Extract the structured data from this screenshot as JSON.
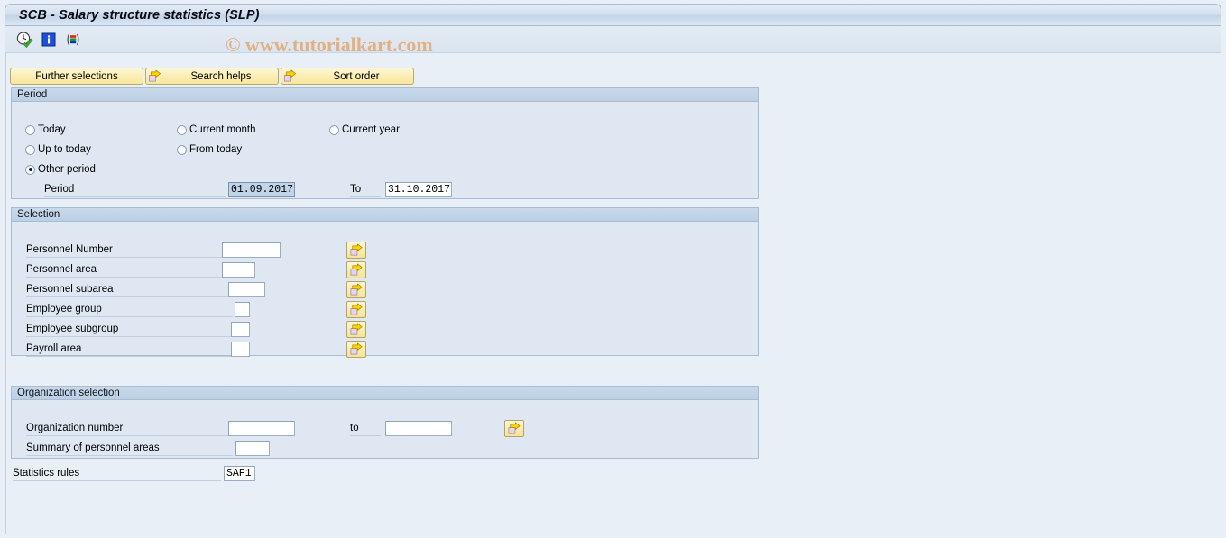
{
  "window": {
    "title": "SCB - Salary structure statistics (SLP)"
  },
  "watermark": {
    "text": "© www.tutorialkart.com"
  },
  "toolbar": {
    "icons": [
      {
        "name": "execute-clock-icon",
        "title": "Execute"
      },
      {
        "name": "information-icon",
        "title": "Information"
      },
      {
        "name": "variant-bars-icon",
        "title": "Get Variant"
      }
    ]
  },
  "buttons": {
    "further_selections": "Further selections",
    "search_helps": "Search helps",
    "sort_order": "Sort order"
  },
  "period": {
    "title": "Period",
    "options": [
      {
        "label": "Today",
        "checked": false
      },
      {
        "label": "Current month",
        "checked": false
      },
      {
        "label": "Current year",
        "checked": false
      },
      {
        "label": "Up to today",
        "checked": false
      },
      {
        "label": "From today",
        "checked": false
      },
      {
        "label": "Other period",
        "checked": true
      }
    ],
    "period_label": "Period",
    "period_from": "01.09.2017",
    "to_label": "To",
    "period_to": "31.10.2017"
  },
  "selection": {
    "title": "Selection",
    "rows": [
      {
        "label": "Personnel Number",
        "value": ""
      },
      {
        "label": "Personnel area",
        "value": ""
      },
      {
        "label": "Personnel subarea",
        "value": ""
      },
      {
        "label": "Employee group",
        "value": ""
      },
      {
        "label": "Employee subgroup",
        "value": ""
      },
      {
        "label": "Payroll area",
        "value": ""
      }
    ]
  },
  "organization": {
    "title": "Organization selection",
    "org_number_label": "Organization number",
    "org_number_from": "",
    "to_label": "to",
    "org_number_to": "",
    "summary_label": "Summary of personnel areas",
    "summary_value": ""
  },
  "statistics": {
    "label": "Statistics rules",
    "value": "SAF1"
  },
  "colors": {
    "page_background": "#e9eff6",
    "group_background": "#dfe8f2",
    "group_header": "#c2d4e8",
    "button_yellow": "#fbeeb4",
    "watermark": "#e2ae7e",
    "selected_field": "#c2d4e8"
  }
}
